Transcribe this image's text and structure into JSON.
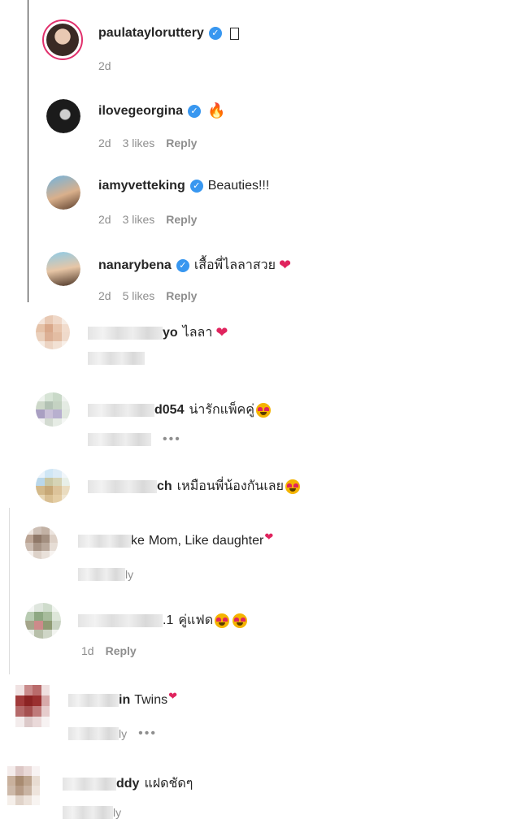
{
  "comments": [
    {
      "username": "paulatayloruttery",
      "text": "",
      "time": "2d"
    },
    {
      "username": "ilovegeorgina",
      "text": "",
      "time": "2d",
      "likes": "3 likes",
      "reply": "Reply"
    },
    {
      "username": "iamyvetteking",
      "text": "Beauties!!!",
      "time": "2d",
      "likes": "3 likes",
      "reply": "Reply"
    },
    {
      "username": "nanarybena",
      "text": "เสื้อพี่ไลลาสวย",
      "time": "2d",
      "likes": "5 likes",
      "reply": "Reply"
    },
    {
      "username_visible": "yo",
      "text": "ไลลา"
    },
    {
      "username_visible": "d054",
      "text": "น่ารักแพ็คคู่",
      "more": "•••"
    },
    {
      "username_visible": "ch",
      "text": "เหมือนพี่น้องกันเลย"
    },
    {
      "username_visible": "ke",
      "text": "Mom, Like daughter",
      "reply_fragment": "ly"
    },
    {
      "username_visible": ".1",
      "text": "คู่แฟด",
      "time": "1d",
      "reply": "Reply"
    },
    {
      "username_visible": "in",
      "text": "Twins",
      "reply_fragment": "ly",
      "more": "•••"
    },
    {
      "username_visible": "ddy",
      "text": "แฝดชัดๆ",
      "reply_fragment": "ly"
    }
  ],
  "icons": {
    "verified": "verified-badge-icon",
    "fire": "fire-emoji",
    "heart": "red-heart-emoji",
    "heart_eyes": "heart-eyes-emoji"
  },
  "colors": {
    "verified": "#3897f0",
    "story_ring": "#e1306c",
    "meta_gray": "#8e8e8e"
  }
}
